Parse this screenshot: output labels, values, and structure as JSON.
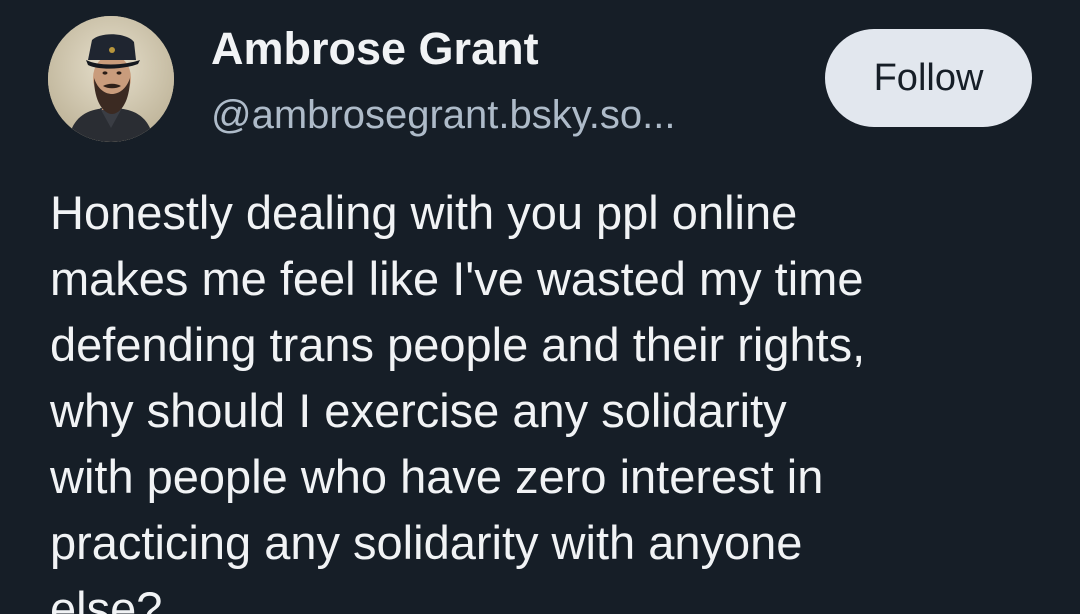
{
  "author": {
    "display_name": "Ambrose Grant",
    "handle": "@ambrosegrant.bsky.so...",
    "avatar_icon": "portrait-photo-icon"
  },
  "actions": {
    "follow_label": "Follow"
  },
  "post": {
    "lines": [
      "Honestly dealing with you ppl online",
      "makes me feel like I've wasted my time",
      "defending trans people and their rights,",
      "why should I exercise any solidarity",
      "with people who have zero interest in",
      "practicing any solidarity with anyone",
      "else?"
    ]
  },
  "colors": {
    "background": "#161e27",
    "text_primary": "#f1f3f5",
    "text_secondary": "#aebbc9",
    "button_bg": "#e2e7ee"
  }
}
